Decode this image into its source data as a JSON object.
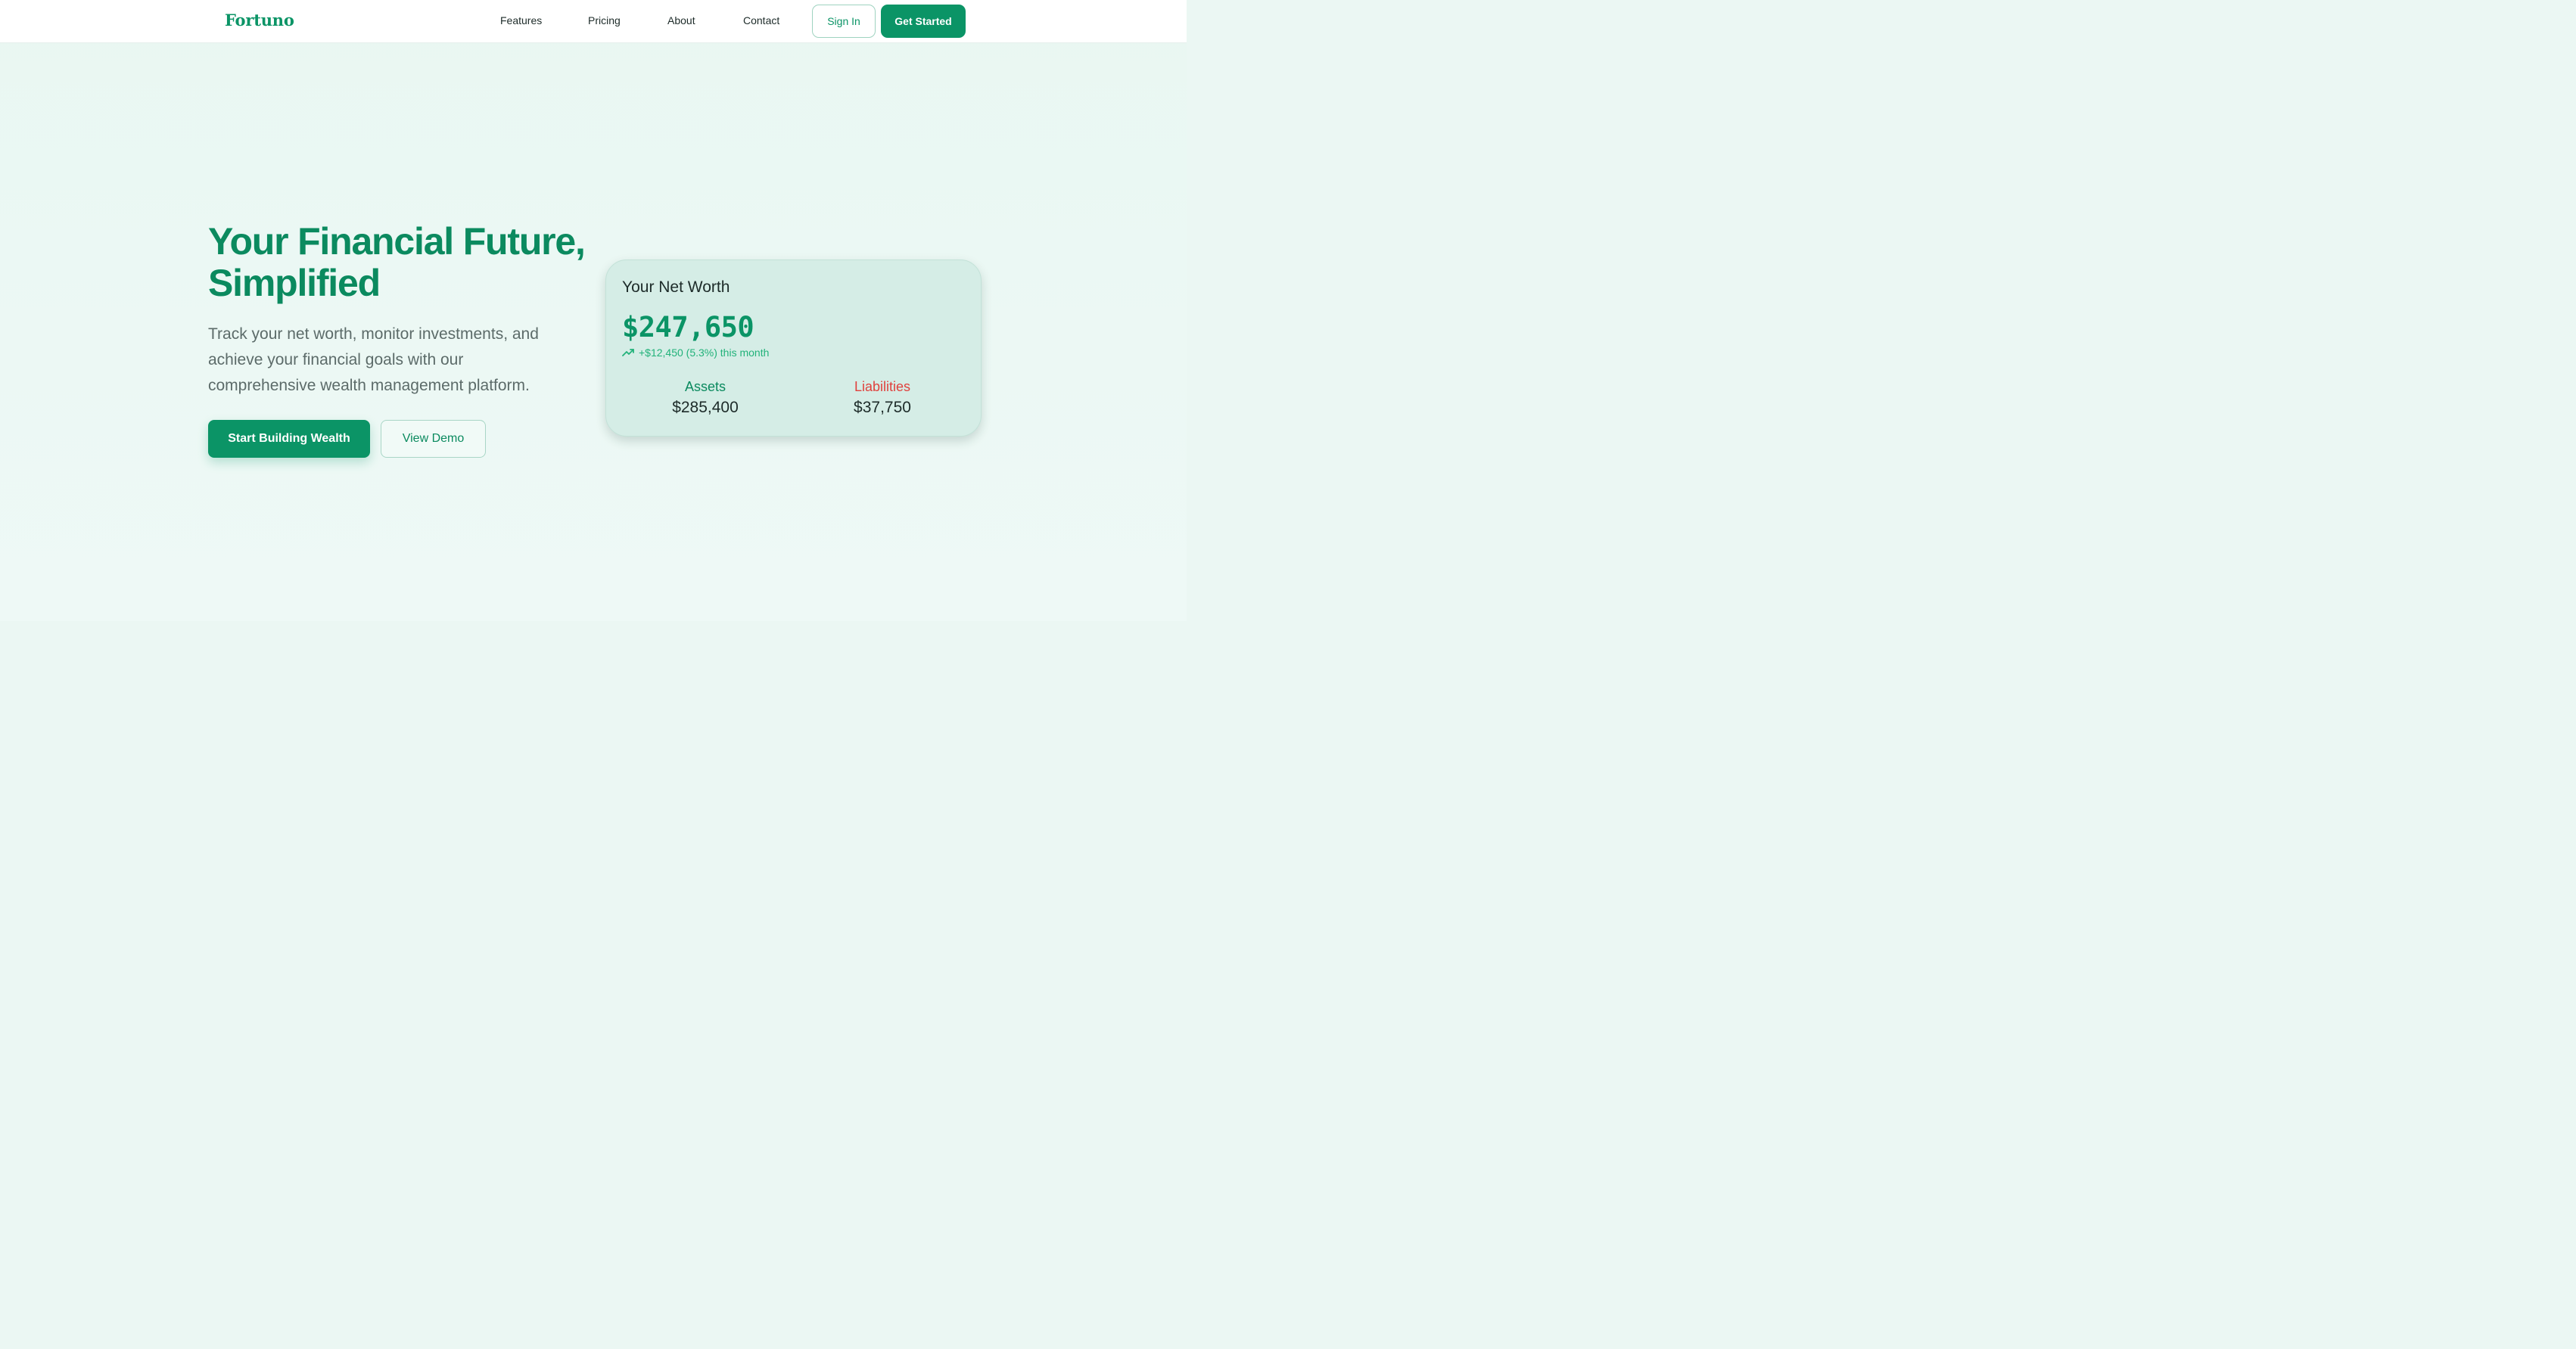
{
  "brand": {
    "name": "Fortuno",
    "accent": "#0b9466"
  },
  "nav": {
    "links": [
      "Features",
      "Pricing",
      "About",
      "Contact"
    ],
    "sign_in": "Sign In",
    "get_started": "Get Started"
  },
  "hero": {
    "title_line1": "Your Financial Future,",
    "title_line2": "Simplified",
    "subtitle": "Track your net worth, monitor investments, and achieve your financial goals with our comprehensive wealth management platform.",
    "primary_cta": "Start Building Wealth",
    "secondary_cta": "View Demo"
  },
  "net_worth_card": {
    "title": "Your Net Worth",
    "amount": "$247,650",
    "change_icon": "trending-up-icon",
    "change_text": "+$12,450 (5.3%) this month",
    "assets_label": "Assets",
    "assets_value": "$285,400",
    "liabilities_label": "Liabilities",
    "liabilities_value": "$37,750",
    "positive_color": "#22b27a",
    "negative_color": "#e0413d"
  }
}
